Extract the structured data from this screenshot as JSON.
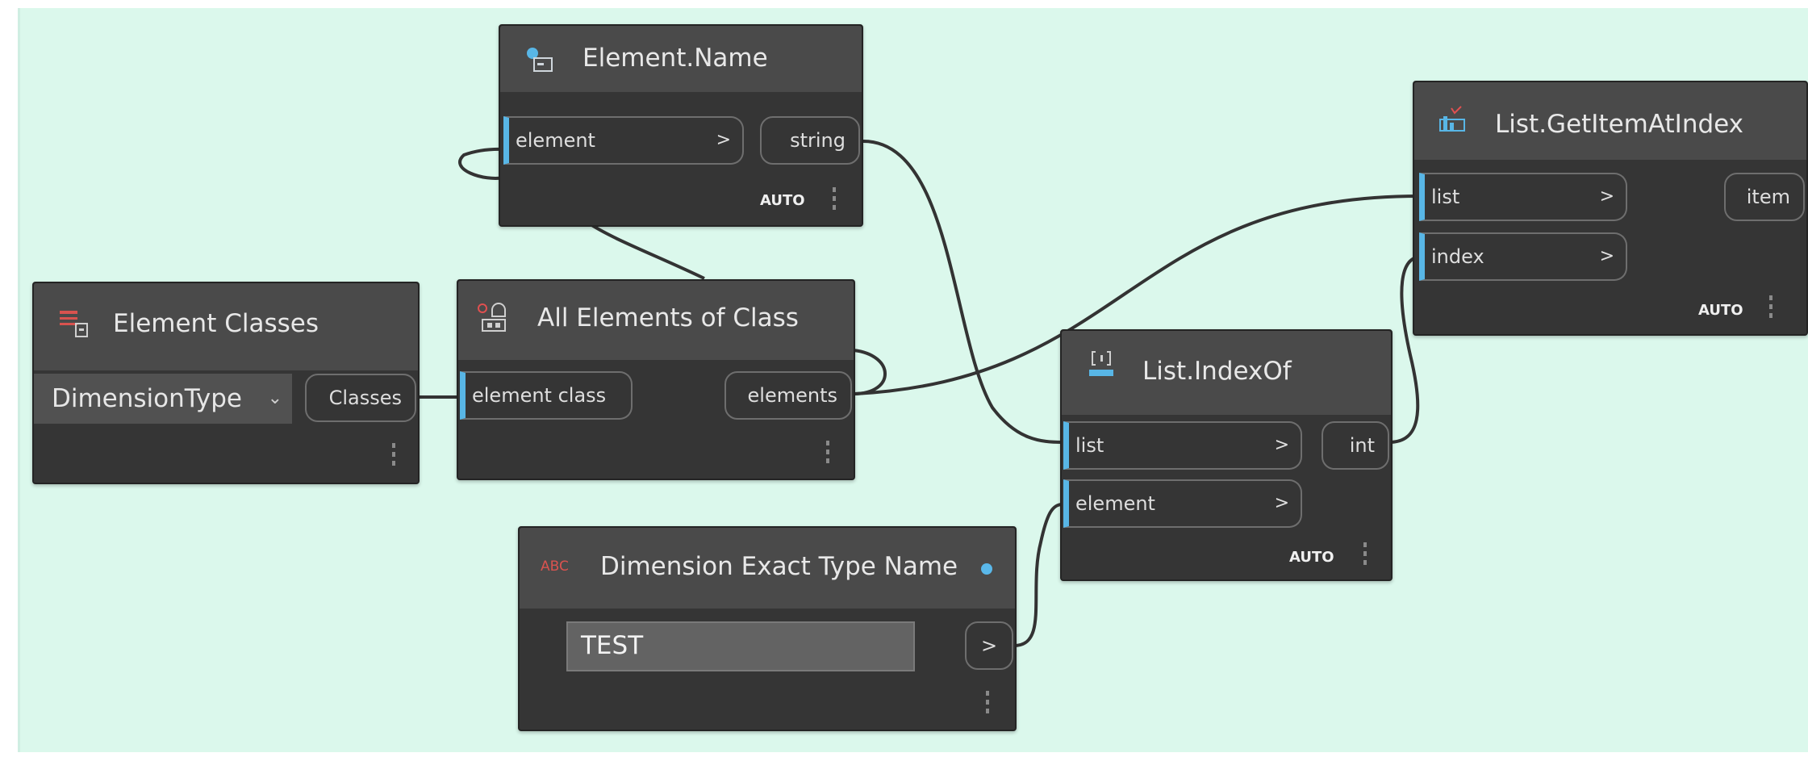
{
  "nodes": {
    "element_name": {
      "title": "Element.Name",
      "inputs": [
        {
          "label": "element",
          "arrow": ">"
        }
      ],
      "outputs": [
        {
          "label": "string"
        }
      ],
      "lacing": "AUTO"
    },
    "list_get_item": {
      "title": "List.GetItemAtIndex",
      "inputs": [
        {
          "label": "list",
          "arrow": ">"
        },
        {
          "label": "index",
          "arrow": ">"
        }
      ],
      "outputs": [
        {
          "label": "item"
        }
      ],
      "lacing": "AUTO"
    },
    "element_classes": {
      "title": "Element Classes",
      "selected": "DimensionType",
      "outputs": [
        {
          "label": "Classes"
        }
      ]
    },
    "all_elements": {
      "title": "All Elements of Class",
      "inputs": [
        {
          "label": "element class"
        }
      ],
      "outputs": [
        {
          "label": "elements"
        }
      ]
    },
    "list_index_of": {
      "title": "List.IndexOf",
      "inputs": [
        {
          "label": "list",
          "arrow": ">"
        },
        {
          "label": "element",
          "arrow": ">"
        }
      ],
      "outputs": [
        {
          "label": "int"
        }
      ],
      "lacing": "AUTO"
    },
    "dimension_name": {
      "title": "Dimension Exact Type Name",
      "value": "TEST",
      "output_arrow": ">",
      "icon_text": "ABC"
    }
  },
  "colors": {
    "canvas": "#dbf8ec",
    "node_body": "#353535",
    "node_header": "#4a4a4a",
    "input_accent": "#58b6e6",
    "wire": "#333333"
  },
  "icons": [
    "list-node-icon",
    "element-node-icon",
    "class-node-icon",
    "index-of-icon",
    "get-item-icon"
  ]
}
